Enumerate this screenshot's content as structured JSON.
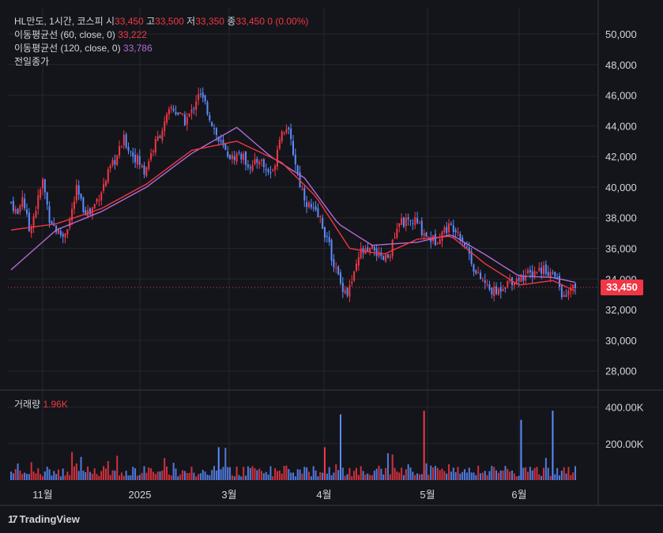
{
  "legend": {
    "symbol": "HL만도, 1시간, 코스피",
    "o_label": "시",
    "o_value": "33,450",
    "h_label": "고",
    "h_value": "33,500",
    "l_label": "저",
    "l_value": "33,350",
    "c_label": "종",
    "c_value": "33,450",
    "change": "0 (0.00%)",
    "ma60_label": "이동평균선 (60, close, 0)",
    "ma60_value": "33,222",
    "ma120_label": "이동평균선 (120, close, 0)",
    "ma120_value": "33,786",
    "prev_close_label": "전일종가",
    "volume_label": "거래량",
    "volume_value": "1.96K"
  },
  "price_tag": "33,450",
  "brand": "TradingView",
  "colors": {
    "up": "#f23645",
    "down": "#5b8cff",
    "ma60": "#f23645",
    "ma120": "#b36ad6",
    "bg": "#14151a",
    "grid": "#24262e"
  },
  "chart_data": {
    "type": "candlestick",
    "y_axis": {
      "ticks": [
        "28,000",
        "30,000",
        "32,000",
        "34,000",
        "36,000",
        "38,000",
        "40,000",
        "42,000",
        "44,000",
        "46,000",
        "48,000",
        "50,000"
      ],
      "ylim": [
        26800,
        51700
      ]
    },
    "volume_axis": {
      "ticks": [
        "200.00K",
        "400.00K"
      ]
    },
    "x_labels": [
      "11월",
      "2025",
      "3월",
      "4월",
      "5월",
      "6월"
    ],
    "last_price": 33450,
    "close_path": [
      [
        0,
        39000
      ],
      [
        3,
        38200
      ],
      [
        5,
        39500
      ],
      [
        8,
        37200
      ],
      [
        11,
        38600
      ],
      [
        14,
        40400
      ],
      [
        17,
        38000
      ],
      [
        20,
        37200
      ],
      [
        23,
        36800
      ],
      [
        26,
        37800
      ],
      [
        29,
        39800
      ],
      [
        32,
        38600
      ],
      [
        35,
        38300
      ],
      [
        38,
        39200
      ],
      [
        41,
        40100
      ],
      [
        44,
        41200
      ],
      [
        47,
        42000
      ],
      [
        50,
        43100
      ],
      [
        53,
        42300
      ],
      [
        56,
        41800
      ],
      [
        59,
        41000
      ],
      [
        62,
        42200
      ],
      [
        65,
        43200
      ],
      [
        68,
        44100
      ],
      [
        71,
        45200
      ],
      [
        74,
        44800
      ],
      [
        77,
        44300
      ],
      [
        80,
        44900
      ],
      [
        83,
        46200
      ],
      [
        86,
        45400
      ],
      [
        89,
        44200
      ],
      [
        92,
        43000
      ],
      [
        95,
        42300
      ],
      [
        98,
        41900
      ],
      [
        101,
        42200
      ],
      [
        104,
        41700
      ],
      [
        107,
        41300
      ],
      [
        110,
        41900
      ],
      [
        113,
        41100
      ],
      [
        116,
        40900
      ],
      [
        119,
        43400
      ],
      [
        122,
        44000
      ],
      [
        125,
        42300
      ],
      [
        128,
        40200
      ],
      [
        131,
        39000
      ],
      [
        134,
        38400
      ],
      [
        137,
        37900
      ],
      [
        140,
        36600
      ],
      [
        143,
        35000
      ],
      [
        146,
        33700
      ],
      [
        149,
        33100
      ],
      [
        152,
        34200
      ],
      [
        155,
        35800
      ],
      [
        158,
        35700
      ],
      [
        161,
        36000
      ],
      [
        164,
        35200
      ],
      [
        167,
        35400
      ],
      [
        170,
        36700
      ],
      [
        173,
        37800
      ],
      [
        176,
        37600
      ],
      [
        179,
        37800
      ],
      [
        182,
        37200
      ],
      [
        185,
        36700
      ],
      [
        188,
        36500
      ],
      [
        191,
        37100
      ],
      [
        194,
        37400
      ],
      [
        197,
        37400
      ],
      [
        200,
        36600
      ],
      [
        203,
        35700
      ],
      [
        206,
        34300
      ],
      [
        209,
        33900
      ],
      [
        212,
        33300
      ],
      [
        215,
        33100
      ],
      [
        218,
        33600
      ],
      [
        221,
        33900
      ],
      [
        224,
        34000
      ],
      [
        227,
        34200
      ],
      [
        230,
        34300
      ],
      [
        233,
        34600
      ],
      [
        236,
        34700
      ],
      [
        239,
        34400
      ],
      [
        242,
        33900
      ],
      [
        245,
        32700
      ],
      [
        248,
        33300
      ],
      [
        250,
        33450
      ]
    ],
    "ma60_path": [
      [
        0,
        37200
      ],
      [
        20,
        37600
      ],
      [
        40,
        38600
      ],
      [
        60,
        40200
      ],
      [
        80,
        42400
      ],
      [
        100,
        43000
      ],
      [
        120,
        41600
      ],
      [
        135,
        39400
      ],
      [
        150,
        36000
      ],
      [
        165,
        35600
      ],
      [
        180,
        36600
      ],
      [
        195,
        36800
      ],
      [
        210,
        35000
      ],
      [
        225,
        33600
      ],
      [
        240,
        33900
      ],
      [
        250,
        33222
      ]
    ],
    "ma120_path": [
      [
        0,
        34600
      ],
      [
        20,
        37200
      ],
      [
        40,
        38400
      ],
      [
        60,
        40000
      ],
      [
        80,
        42200
      ],
      [
        100,
        43900
      ],
      [
        115,
        42000
      ],
      [
        130,
        40600
      ],
      [
        145,
        37600
      ],
      [
        160,
        36200
      ],
      [
        180,
        36400
      ],
      [
        195,
        36900
      ],
      [
        210,
        35600
      ],
      [
        225,
        34200
      ],
      [
        240,
        34100
      ],
      [
        250,
        33786
      ]
    ]
  }
}
